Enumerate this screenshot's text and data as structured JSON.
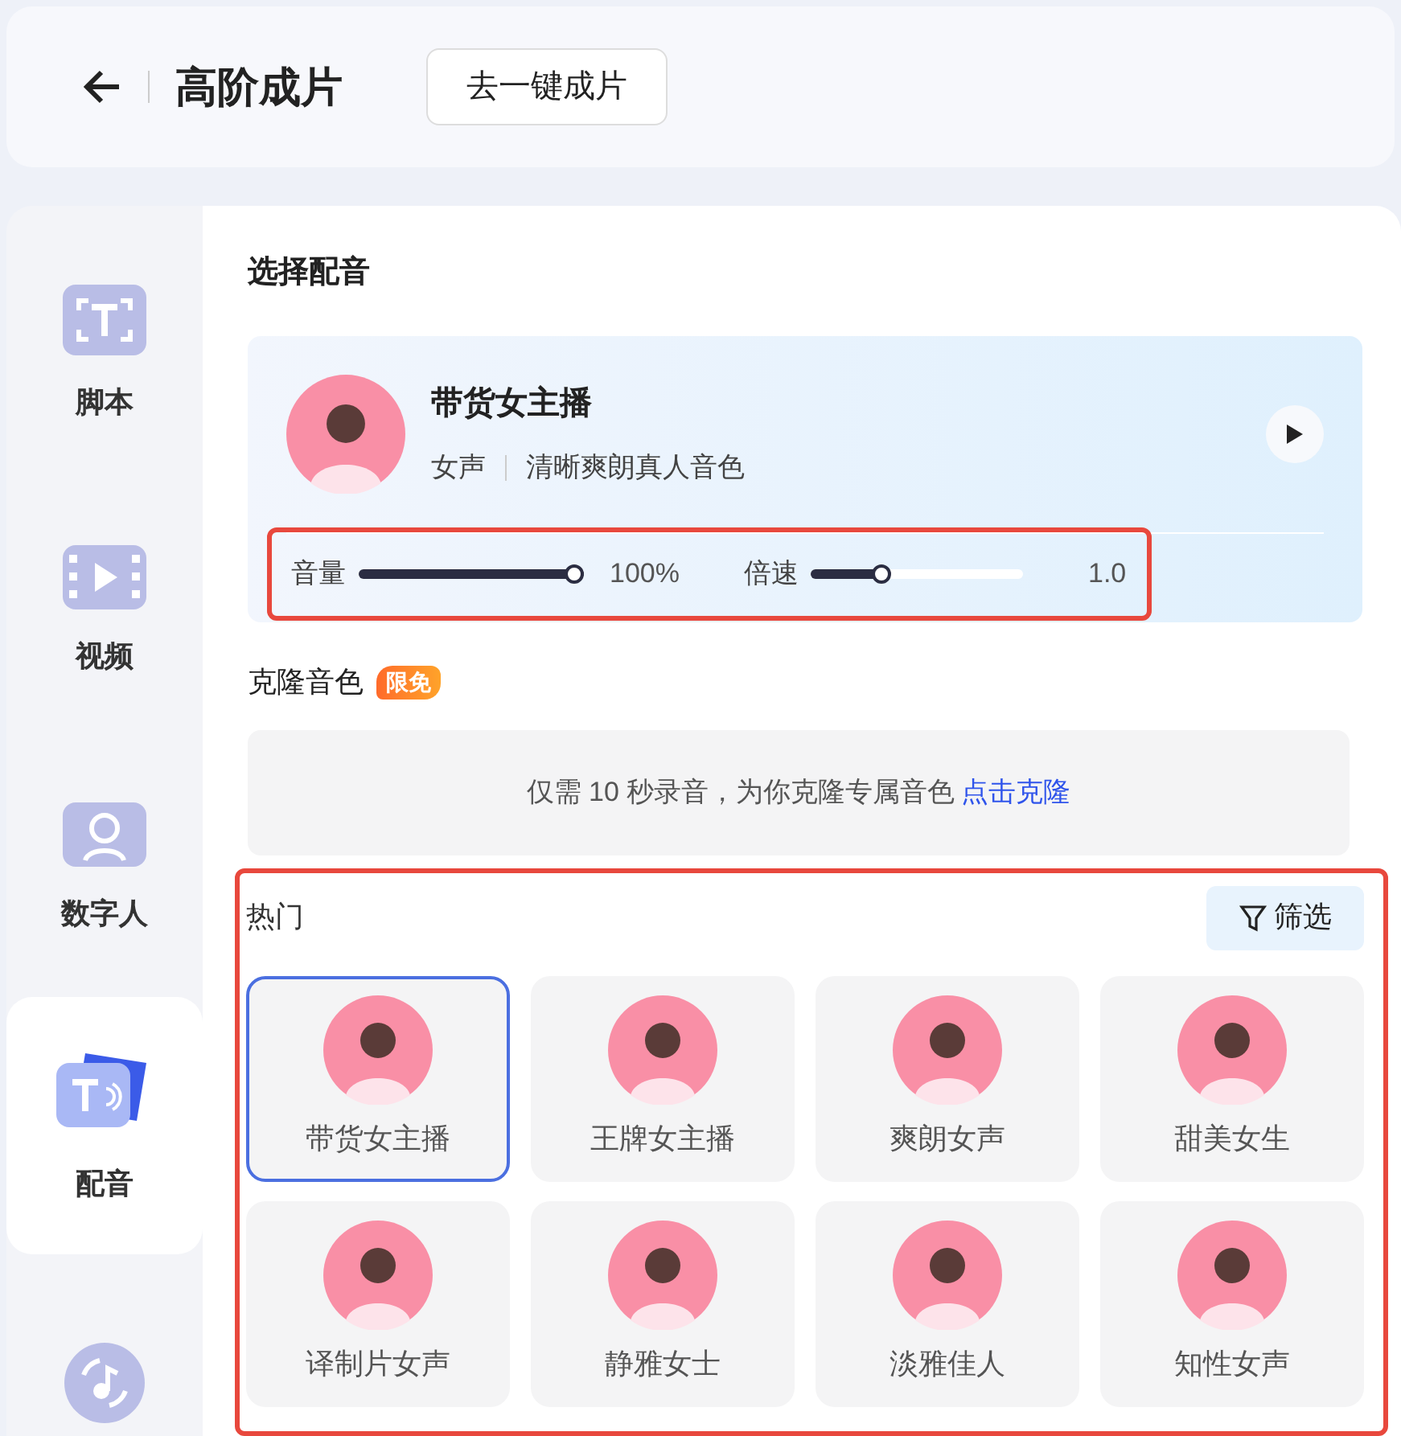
{
  "header": {
    "title": "高阶成片",
    "button": "去一键成片"
  },
  "sidebar": {
    "items": [
      {
        "label": "脚本",
        "kind": "script",
        "selected": false
      },
      {
        "label": "视频",
        "kind": "video",
        "selected": false
      },
      {
        "label": "数字人",
        "kind": "avatar",
        "selected": false
      },
      {
        "label": "配音",
        "kind": "voice",
        "selected": true
      },
      {
        "kind": "music",
        "selected": false
      }
    ]
  },
  "section_title": "选择配音",
  "current_voice": {
    "name": "带货女主播",
    "gender": "女声",
    "description": "清晰爽朗真人音色",
    "sliders": [
      {
        "label": "音量",
        "level": 1.0,
        "reading": "100%"
      },
      {
        "label": "倍速",
        "level": 0.33,
        "reading": "1.0"
      }
    ],
    "highlighted": true
  },
  "clone": {
    "title": "克隆音色",
    "badge": "限免",
    "prompt": "仅需 10 秒录音，为你克隆专属音色",
    "link": "点击克隆"
  },
  "hot": {
    "title": "热门",
    "filter": "筛选",
    "highlighted": true,
    "voices": [
      {
        "name": "带货女主播",
        "selected": true
      },
      {
        "name": "王牌女主播",
        "selected": false
      },
      {
        "name": "爽朗女声",
        "selected": false
      },
      {
        "name": "甜美女生",
        "selected": false
      },
      {
        "name": "译制片女声",
        "selected": false
      },
      {
        "name": "静雅女士",
        "selected": false
      },
      {
        "name": "淡雅佳人",
        "selected": false
      },
      {
        "name": "知性女声",
        "selected": false
      }
    ]
  }
}
